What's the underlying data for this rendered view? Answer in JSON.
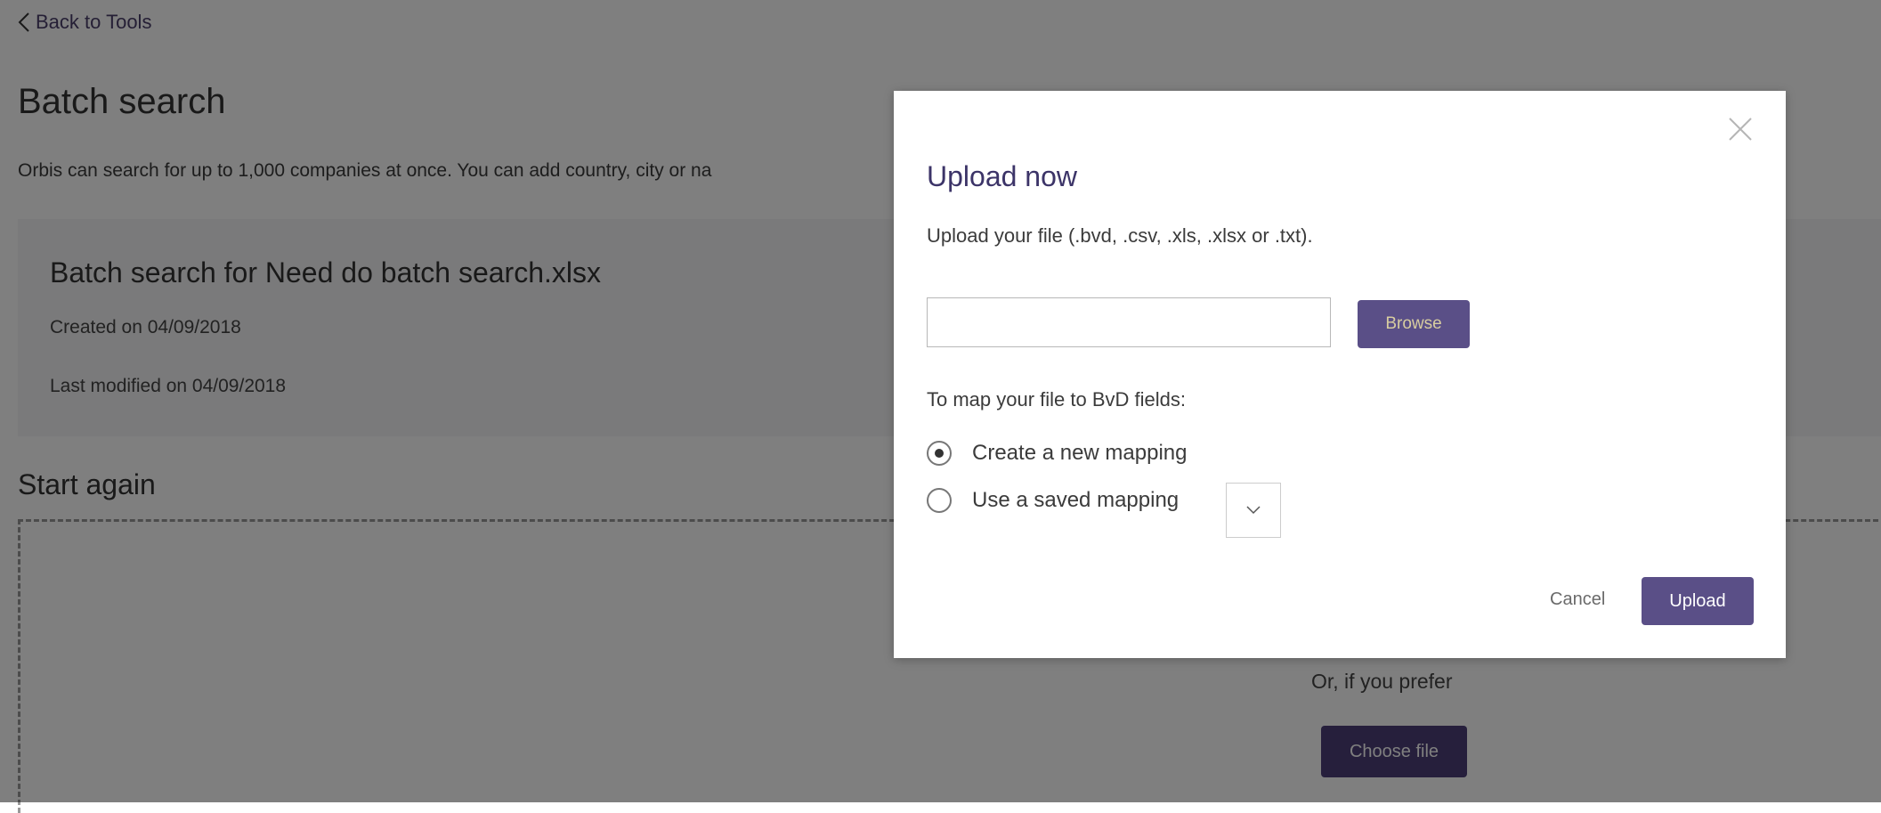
{
  "back_link": {
    "label": "Back to Tools",
    "icon": "chevron-left-icon"
  },
  "page": {
    "title": "Batch search",
    "intro": "Orbis can search for up to 1,000 companies at once. You can add country, city or na"
  },
  "summary": {
    "title": "Batch search for Need do batch search.xlsx",
    "created": "Created on  04/09/2018",
    "modified": "Last modified on  04/09/2018"
  },
  "start_again": {
    "heading": "Start again",
    "or_prefer": "Or, if you prefer",
    "choose_file_label": "Choose file"
  },
  "modal": {
    "title": "Upload now",
    "instruction": "Upload your file (.bvd, .csv, .xls, .xlsx or .txt).",
    "file_input_value": "",
    "browse_label": "Browse",
    "map_label": "To map your file to BvD fields:",
    "options": [
      {
        "label": "Create a new mapping",
        "checked": true
      },
      {
        "label": "Use a saved mapping",
        "checked": false
      }
    ],
    "saved_mapping_selected": "",
    "cancel_label": "Cancel",
    "upload_label": "Upload",
    "close_icon": "close-icon"
  },
  "colors": {
    "accent": "#5a4f87",
    "choose_file": "#4c3f78",
    "overlay": "rgba(0,0,0,0.5)"
  }
}
